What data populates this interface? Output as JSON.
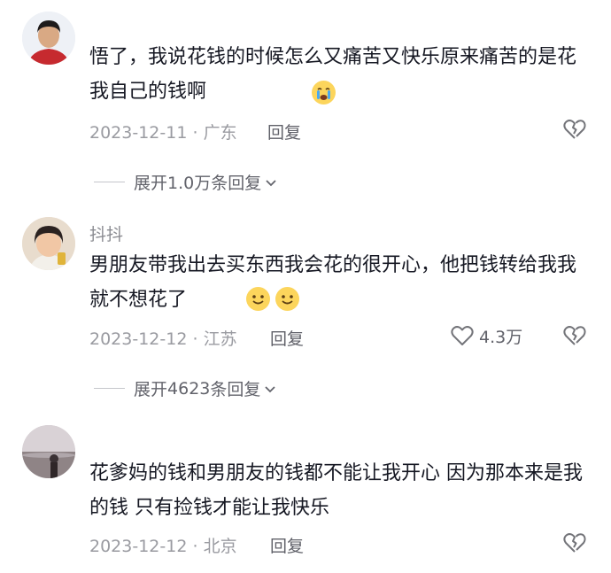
{
  "comments": [
    {
      "username": "",
      "text": "悟了，我说花钱的时候怎么又痛苦又快乐原来痛苦的是花我自己的钱啊",
      "date": "2023-12-11",
      "location": "广东",
      "reply_label": "回复",
      "likes": "",
      "expand": {
        "prefix": "展开",
        "count": "1.0万",
        "suffix": "条回复"
      }
    },
    {
      "username": "抖抖",
      "text": "男朋友带我出去买东西我会花的很开心，他把钱转给我我就不想花了",
      "date": "2023-12-12",
      "location": "江苏",
      "reply_label": "回复",
      "likes": "4.3万",
      "expand": {
        "prefix": "展开",
        "count": "4623",
        "suffix": "条回复"
      }
    },
    {
      "username": "",
      "text": "花爹妈的钱和男朋友的钱都不能让我开心 因为那本来是我的钱 只有捡钱才能让我快乐",
      "date": "2023-12-12",
      "location": "北京",
      "reply_label": "回复",
      "likes": ""
    }
  ],
  "icons": [
    "heart-icon",
    "broken-heart-icon",
    "chevron-down-icon",
    "crying-face-emoji",
    "smiling-face-emoji"
  ],
  "colors": {
    "primary_text": "#161823",
    "secondary_text": "#9a9ba1",
    "emoji_yellow": "#fcd55c"
  }
}
